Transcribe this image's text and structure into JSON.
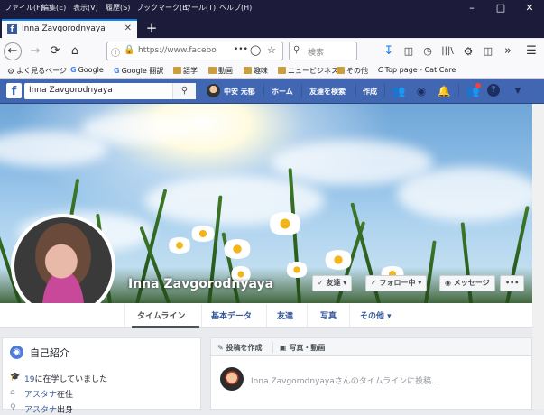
{
  "browser": {
    "menu": [
      "ファイル(F)",
      "編集(E)",
      "表示(V)",
      "履歴(S)",
      "ブックマーク(B)",
      "ツール(T)",
      "ヘルプ(H)"
    ],
    "tab_title": "Inna Zavgorodnyaya",
    "tab_favicon": "f",
    "url": "https://www.facebo",
    "url_more": "•••",
    "search_placeholder": "検索",
    "bookmarks": [
      "よく見るページ",
      "Google",
      "Google 翻訳",
      "語学",
      "動画",
      "趣味",
      "ニュービジネス",
      "その他",
      "Top page - Cat Care"
    ]
  },
  "facebook": {
    "logo": "f",
    "search_value": "Inna  Zavgorodnyaya",
    "user_name": "中安 元郁",
    "nav": {
      "home": "ホーム",
      "find_friends": "友達を検索",
      "create": "作成"
    }
  },
  "profile": {
    "name": "Inna Zavgorodnyaya",
    "buttons": {
      "friends": "友達",
      "following": "フォロー中",
      "message": "メッセージ",
      "more": "•••"
    },
    "tabs": [
      "タイムライン",
      "基本データ",
      "友達",
      "写真",
      "その他"
    ]
  },
  "intro": {
    "heading": "自己紹介",
    "lines": [
      {
        "link": "19",
        "text": "に在学していました"
      },
      {
        "link": "アスタナ",
        "text": "在住"
      },
      {
        "link": "アスタナ",
        "text": "出身"
      }
    ]
  },
  "composer": {
    "create_post": "投稿を作成",
    "photo_video": "写真・動画",
    "placeholder": "Inna  Zavgorodnyayaさんのタイムラインに投稿..."
  },
  "colors": {
    "fb_blue": "#4267b2",
    "link": "#365899",
    "firefox_dark": "#1c1b3a"
  }
}
